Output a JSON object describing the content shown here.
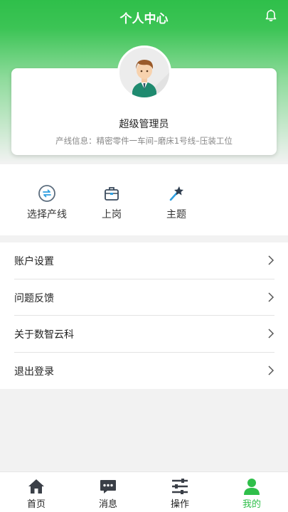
{
  "header": {
    "title": "个人中心",
    "bell_icon": "bell-icon"
  },
  "profile": {
    "name": "超级管理员",
    "line_info": "产线信息：精密零件一车间–磨床1号线–压装工位"
  },
  "actions": [
    {
      "label": "选择产线",
      "icon": "swap-icon"
    },
    {
      "label": "上岗",
      "icon": "briefcase-icon"
    },
    {
      "label": "主题",
      "icon": "magic-wand-icon"
    }
  ],
  "menu": [
    {
      "label": "账户设置"
    },
    {
      "label": "问题反馈"
    },
    {
      "label": "关于数智云科"
    },
    {
      "label": "退出登录"
    }
  ],
  "tabs": [
    {
      "label": "首页",
      "icon": "home-icon"
    },
    {
      "label": "消息",
      "icon": "message-icon"
    },
    {
      "label": "操作",
      "icon": "sliders-icon"
    },
    {
      "label": "我的",
      "icon": "user-icon",
      "active": true
    }
  ],
  "colors": {
    "accent": "#2fbf4a"
  }
}
